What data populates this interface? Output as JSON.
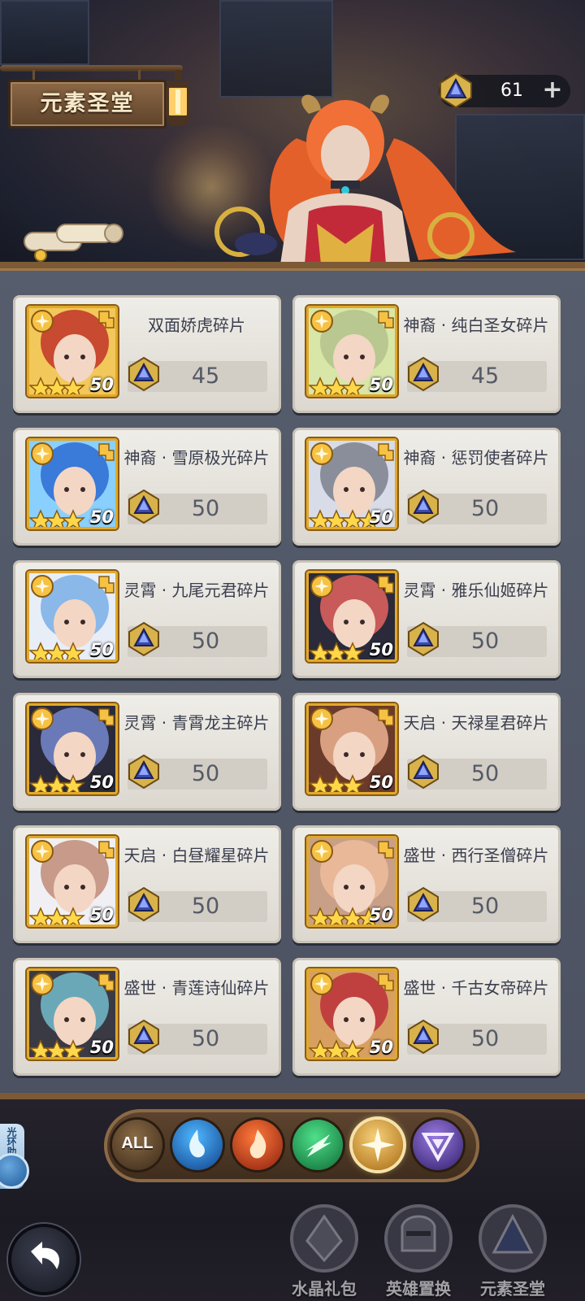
{
  "header": {
    "title": "元素圣堂",
    "currency": {
      "icon": "crystal-icon",
      "value": "61",
      "add_label": "+"
    }
  },
  "shop": {
    "items": [
      {
        "name": "双面娇虎碎片",
        "price": "45",
        "level": "50",
        "stars": 3,
        "element": "light",
        "icon": "hero-portrait-fox-goggles"
      },
      {
        "name": "神裔 · 纯白圣女碎片",
        "price": "45",
        "level": "50",
        "stars": 3,
        "element": "light",
        "icon": "hero-portrait-white-saint"
      },
      {
        "name": "神裔 · 雪原极光碎片",
        "price": "50",
        "level": "50",
        "stars": 3,
        "element": "light",
        "icon": "hero-portrait-blue-hair"
      },
      {
        "name": "神裔 · 惩罚使者碎片",
        "price": "50",
        "level": "50",
        "stars": 4,
        "element": "light",
        "icon": "hero-portrait-blindfold"
      },
      {
        "name": "灵霄 · 九尾元君碎片",
        "price": "50",
        "level": "50",
        "stars": 3,
        "element": "light",
        "icon": "hero-portrait-nine-tail"
      },
      {
        "name": "灵霄 · 雅乐仙姬碎片",
        "price": "50",
        "level": "50",
        "stars": 3,
        "element": "light",
        "icon": "hero-portrait-music-fairy"
      },
      {
        "name": "灵霄 · 青霄龙主碎片",
        "price": "50",
        "level": "50",
        "stars": 3,
        "element": "light",
        "icon": "hero-portrait-dragon-lord"
      },
      {
        "name": "天启 · 天禄星君碎片",
        "price": "50",
        "level": "50",
        "stars": 3,
        "element": "light",
        "icon": "hero-portrait-glasses-girl"
      },
      {
        "name": "天启 · 白昼耀星碎片",
        "price": "50",
        "level": "50",
        "stars": 3,
        "element": "light",
        "icon": "hero-portrait-white-star"
      },
      {
        "name": "盛世 · 西行圣僧碎片",
        "price": "50",
        "level": "50",
        "stars": 4,
        "element": "light",
        "icon": "hero-portrait-monk"
      },
      {
        "name": "盛世 · 青莲诗仙碎片",
        "price": "50",
        "level": "50",
        "stars": 3,
        "element": "light",
        "icon": "hero-portrait-poet"
      },
      {
        "name": "盛世 · 千古女帝碎片",
        "price": "50",
        "level": "50",
        "stars": 3,
        "element": "light",
        "icon": "hero-portrait-empress"
      }
    ]
  },
  "filters": [
    {
      "label": "ALL",
      "icon": "all-filter-icon",
      "active": false
    },
    {
      "label": "",
      "icon": "water-element-icon",
      "active": false
    },
    {
      "label": "",
      "icon": "fire-element-icon",
      "active": false
    },
    {
      "label": "",
      "icon": "wind-element-icon",
      "active": false
    },
    {
      "label": "",
      "icon": "light-element-icon",
      "active": true
    },
    {
      "label": "",
      "icon": "dark-element-icon",
      "active": false
    }
  ],
  "side_helper": {
    "label": "光环助手"
  },
  "bottom_nav": [
    {
      "label": "水晶礼包",
      "icon": "crystal-gift-icon"
    },
    {
      "label": "英雄置换",
      "icon": "hero-swap-icon"
    },
    {
      "label": "元素圣堂",
      "icon": "element-hall-icon"
    }
  ],
  "colors": {
    "panel": "#50566a",
    "card": "#e9e6e0",
    "gold_frame": "#e0a92a",
    "wood": "#7d5a36",
    "text_dark": "#3a3e4e"
  }
}
